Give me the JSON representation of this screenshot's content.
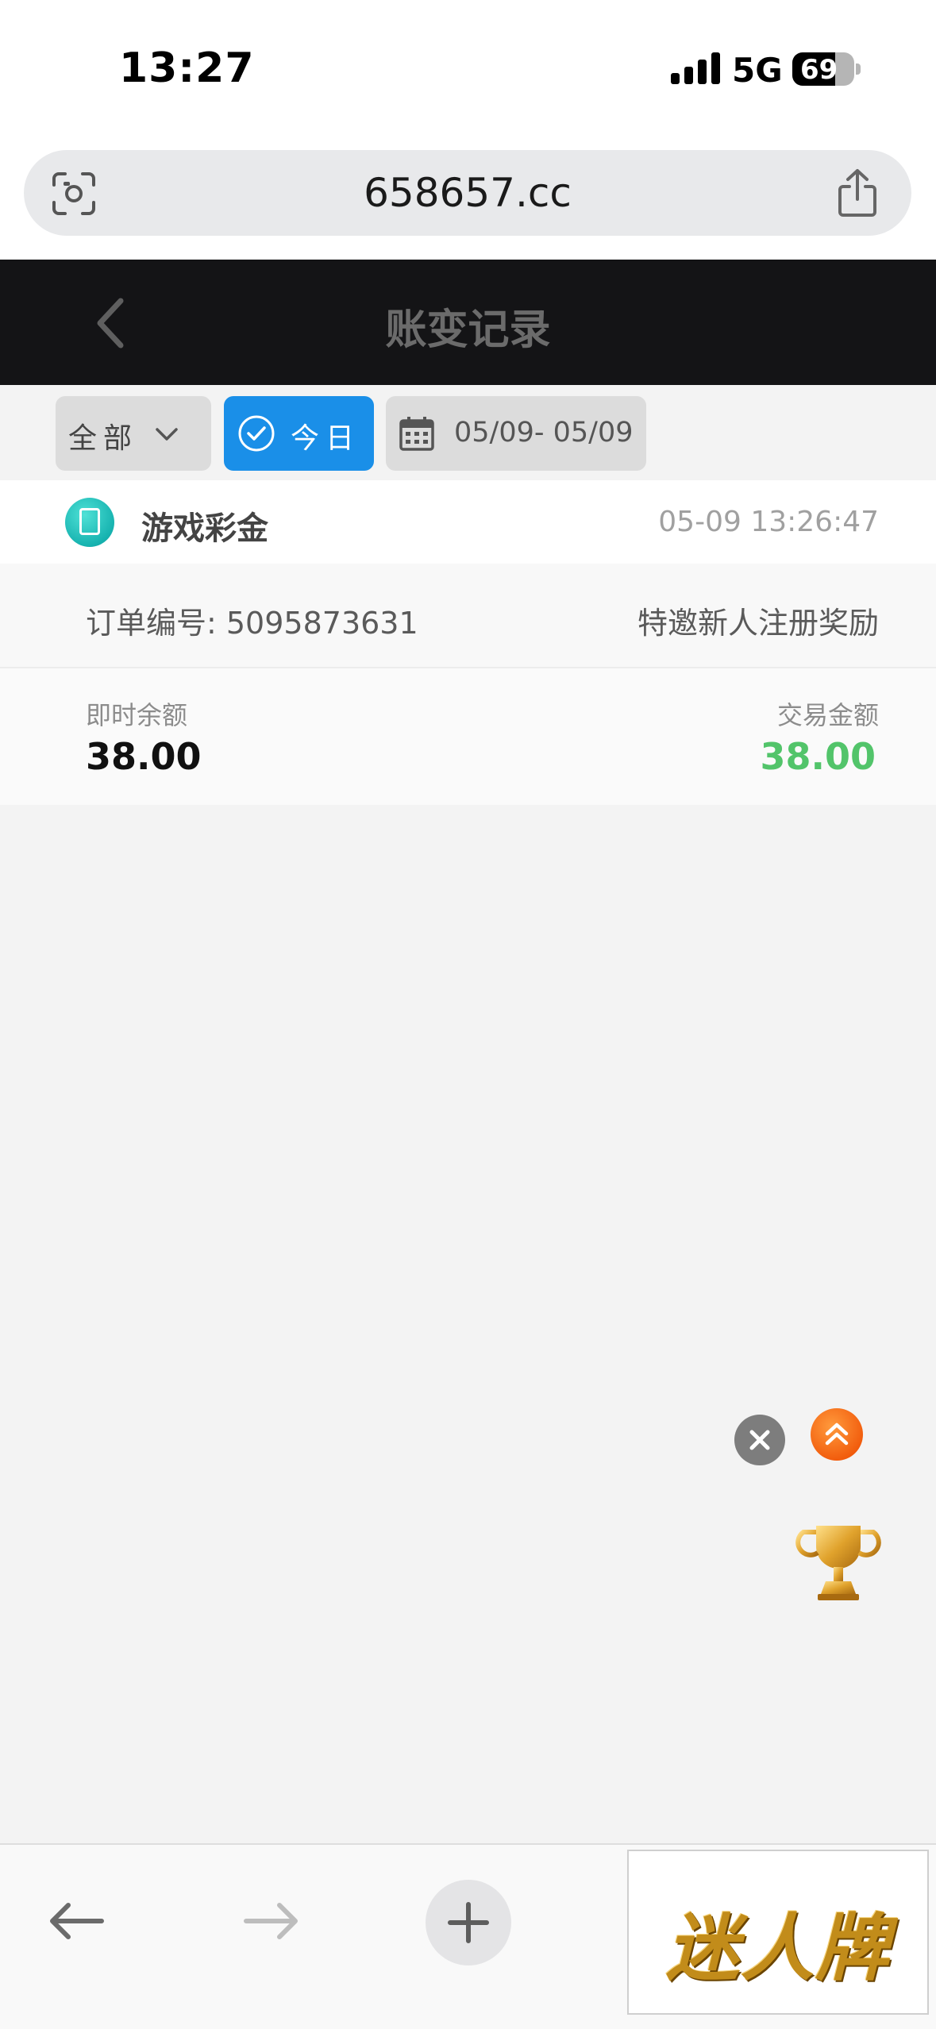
{
  "status_bar": {
    "time": "13:27",
    "network": "5G",
    "battery": "69"
  },
  "browser": {
    "url": "658657.cc"
  },
  "header": {
    "title": "账变记录"
  },
  "filters": {
    "type_label": "全部",
    "today_label": "今日",
    "date_range": "05/09- 05/09"
  },
  "record": {
    "title": "游戏彩金",
    "time": "05-09 13:26:47",
    "order_label": "订单编号: 5095873631",
    "description": "特邀新人注册奖励",
    "balance_label": "即时余额",
    "balance_value": "38.00",
    "amount_label": "交易金额",
    "amount_value": "38.00"
  },
  "ad": {
    "text": "迷人牌"
  },
  "colors": {
    "header_bg": "#141416",
    "accent_blue": "#1a8fe8",
    "amount_green": "#52c46a",
    "float_orange": "#f15a0b"
  }
}
